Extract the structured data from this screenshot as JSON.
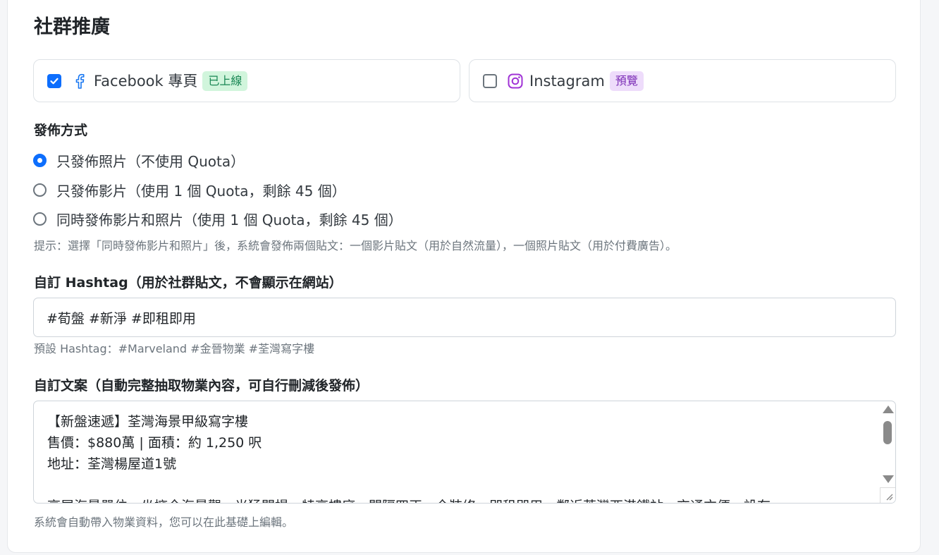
{
  "section": {
    "title": "社群推廣"
  },
  "platforms": [
    {
      "name": "Facebook 專頁",
      "checked": true,
      "badge": "已上線",
      "icon": "facebook-icon",
      "badge_color": "#198754"
    },
    {
      "name": "Instagram",
      "checked": false,
      "badge": "預覽",
      "icon": "instagram-icon",
      "badge_color": "#7b2cb6"
    }
  ],
  "publish": {
    "label": "發佈方式",
    "options": [
      {
        "label": "只發佈照片（不使用 Quota）",
        "selected": true
      },
      {
        "label": "只發佈影片（使用 1 個 Quota，剩餘 45 個）",
        "selected": false
      },
      {
        "label": "同時發佈影片和照片（使用 1 個 Quota，剩餘 45 個）",
        "selected": false
      }
    ],
    "hint": "提示：選擇「同時發佈影片和照片」後，系統會發佈兩個貼文：一個影片貼文（用於自然流量），一個照片貼文（用於付費廣告）。"
  },
  "hashtag": {
    "label": "自訂 Hashtag（用於社群貼文，不會顯示在網站）",
    "value": "#荀盤 #新淨 #即租即用",
    "hint": "預設 Hashtag：#Marveland #金晉物業 #荃灣寫字樓"
  },
  "copy": {
    "label": "自訂文案（自動完整抽取物業內容，可自行刪減後發佈）",
    "lines": [
      "【新盤速遞】荃灣海景甲級寫字樓",
      "售價：$880萬 | 面積：約 1,250 呎",
      "地址：荃灣楊屋道1號",
      "",
      "高層海景單位，坐擁全海景觀，光猛開揚，特高樓底，間隔四正，全裝修，即租即用，鄰近荃灣西港鐵站，交通方便，設有"
    ],
    "hint": "系統會自動帶入物業資料，您可以在此基礎上編輯。"
  },
  "colors": {
    "primary": "#0d6efd",
    "facebook": "#1877f2",
    "instagram": "#a033d6"
  }
}
